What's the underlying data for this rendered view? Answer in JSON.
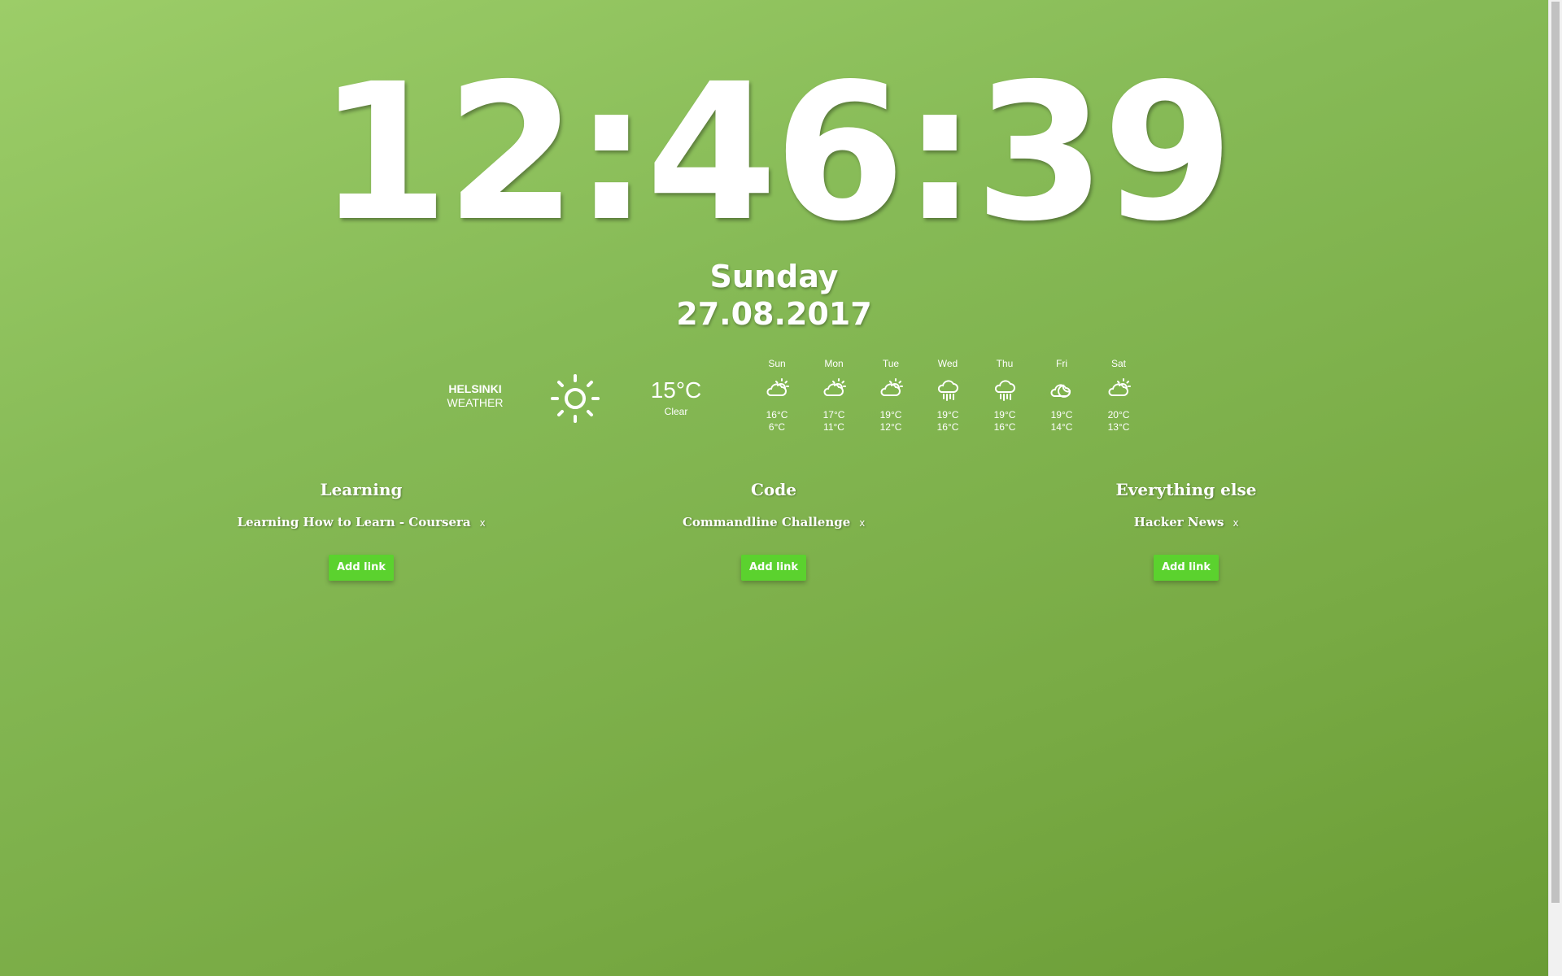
{
  "clock": {
    "time": "12:46:39",
    "day": "Sunday",
    "date": "27.08.2017"
  },
  "weather": {
    "city": "HELSINKI",
    "label": "WEATHER",
    "current_icon": "sun-icon",
    "current_temp": "15°C",
    "current_condition": "Clear",
    "forecast": [
      {
        "day": "Sun",
        "icon": "partly-cloudy-icon",
        "high": "16°C",
        "low": "6°C"
      },
      {
        "day": "Mon",
        "icon": "partly-cloudy-icon",
        "high": "17°C",
        "low": "11°C"
      },
      {
        "day": "Tue",
        "icon": "partly-cloudy-icon",
        "high": "19°C",
        "low": "12°C"
      },
      {
        "day": "Wed",
        "icon": "rain-icon",
        "high": "19°C",
        "low": "16°C"
      },
      {
        "day": "Thu",
        "icon": "rain-icon",
        "high": "19°C",
        "low": "16°C"
      },
      {
        "day": "Fri",
        "icon": "cloudy-moon-icon",
        "high": "19°C",
        "low": "14°C"
      },
      {
        "day": "Sat",
        "icon": "partly-cloudy-icon",
        "high": "20°C",
        "low": "13°C"
      }
    ]
  },
  "columns": [
    {
      "title": "Learning",
      "links": [
        {
          "text": "Learning How to Learn - Coursera",
          "remove": "x"
        }
      ],
      "add_label": "Add link"
    },
    {
      "title": "Code",
      "links": [
        {
          "text": "Commandline Challenge",
          "remove": "x"
        }
      ],
      "add_label": "Add link"
    },
    {
      "title": "Everything else",
      "links": [
        {
          "text": "Hacker News",
          "remove": "x"
        }
      ],
      "add_label": "Add link"
    }
  ],
  "colors": {
    "background_start": "#9ccd68",
    "background_end": "#6a9c35",
    "button": "#5bd22e",
    "text": "#ffffff"
  }
}
